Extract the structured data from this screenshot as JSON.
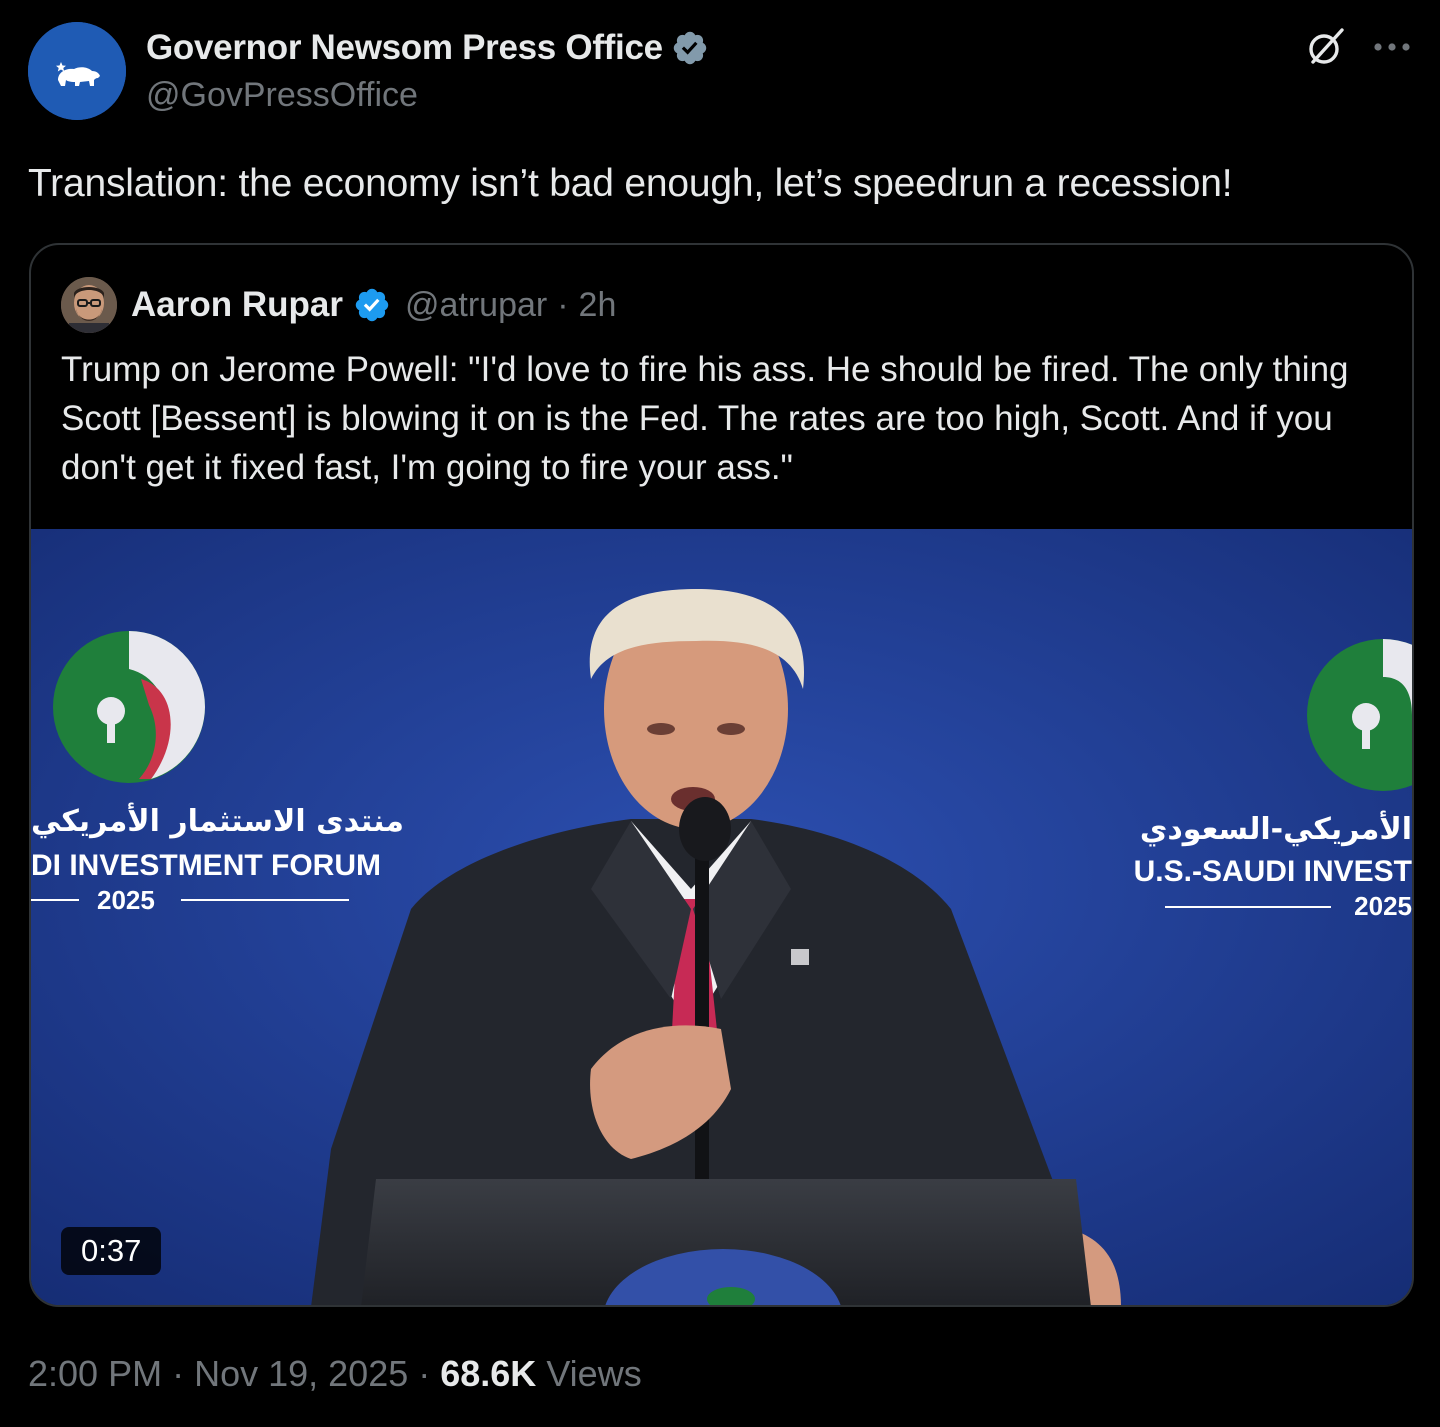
{
  "author": {
    "display_name": "Governor Newsom Press Office",
    "handle": "@GovPressOffice",
    "verified": "gray-verified-badge",
    "avatar_icon": "california-bear-icon",
    "avatar_color": "#1f5bb4"
  },
  "tweet": {
    "text": "Translation: the economy isn’t bad enough, let’s speedrun a recession!"
  },
  "quote": {
    "display_name": "Aaron Rupar",
    "handle": "@atrupar",
    "separator": "·",
    "time": "2h",
    "verified": "blue-verified-badge",
    "text": "Trump on Jerome Powell: \"I'd love to fire his ass. He should be fired. The only thing Scott [Bessent] is blowing it on is the Fed. The rates are too high, Scott. And if you don't get it fixed fast, I'm going to fire your ass.\"",
    "media": {
      "type": "video",
      "duration": "0:37",
      "backdrop_left": {
        "arabic": "منتدى الاستثمار الأمريكي",
        "english": "DI INVESTMENT FORUM",
        "year": "2025"
      },
      "backdrop_right": {
        "arabic": "الأمريكي-السعودي",
        "english": "U.S.-SAUDI INVEST",
        "year": "2025"
      }
    }
  },
  "footer": {
    "time": "2:00 PM",
    "sep1": "·",
    "date": "Nov 19, 2025",
    "sep2": "·",
    "views_count": "68.6K",
    "views_label": "Views"
  },
  "colors": {
    "background": "#000000",
    "primary_text": "#e7e9ea",
    "secondary_text": "#71767b",
    "verified_blue": "#1d9bf0",
    "verified_gray": "#829aab",
    "border": "#2f3336"
  }
}
